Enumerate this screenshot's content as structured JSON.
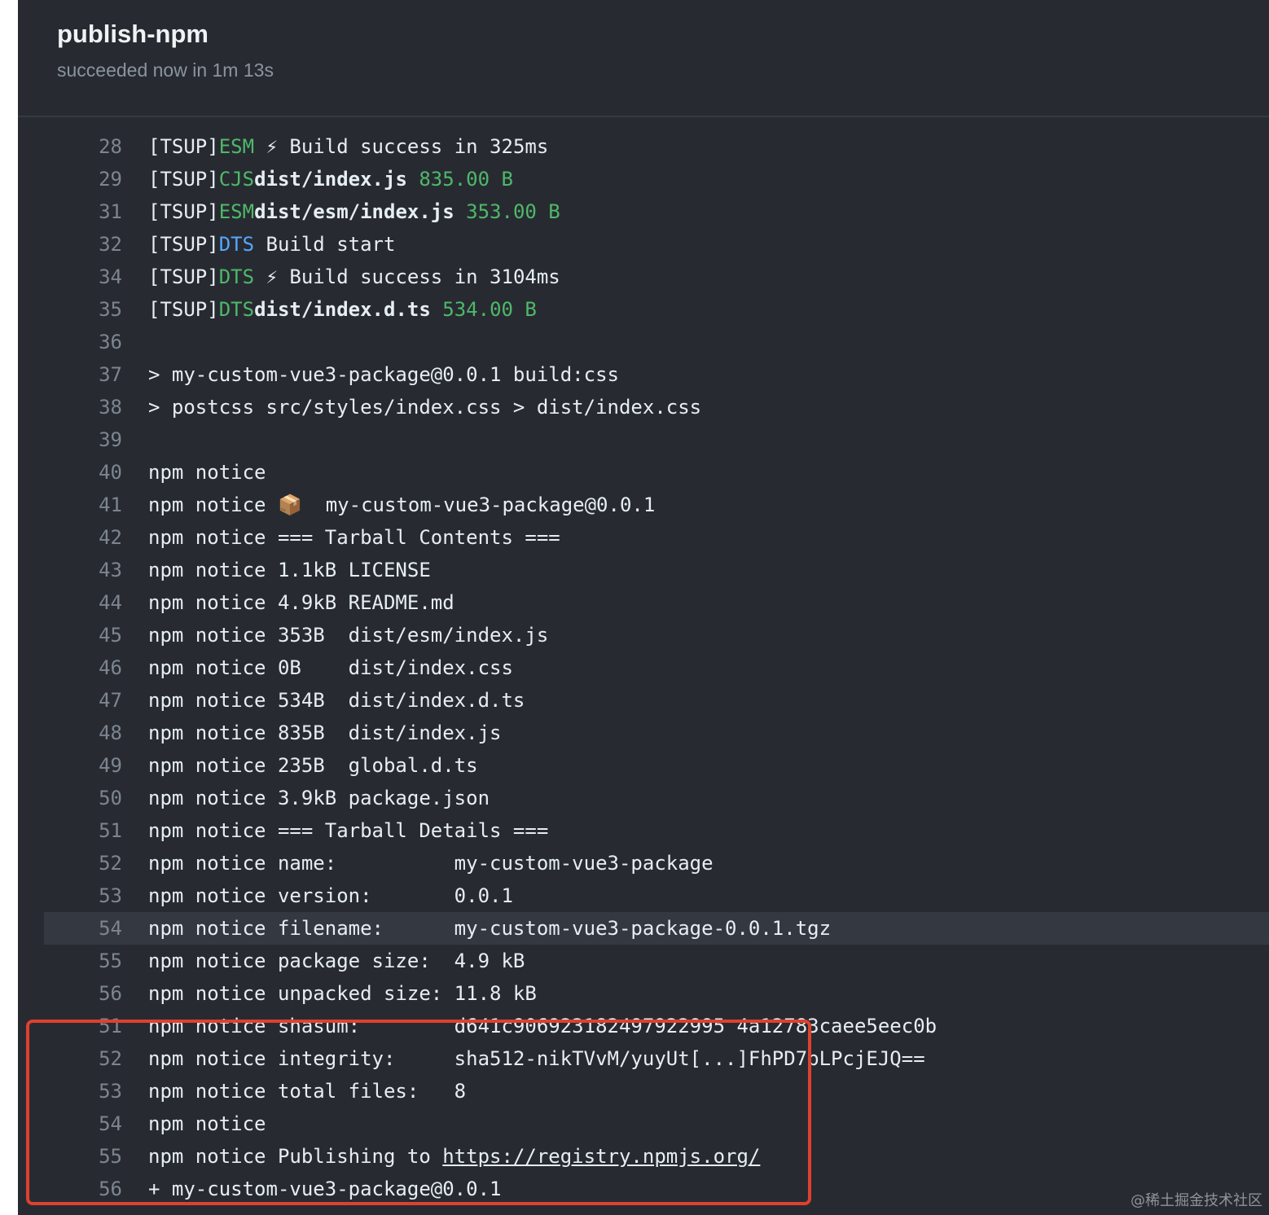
{
  "job": {
    "title": "publish-npm",
    "status": "succeeded now in 1m 13s"
  },
  "log_lines": [
    {
      "num": "28",
      "segments": [
        {
          "t": "[TSUP]"
        },
        {
          "t": "ESM",
          "c": "green"
        },
        {
          "t": " ⚡ Build success in 325ms"
        }
      ]
    },
    {
      "num": "29",
      "segments": [
        {
          "t": "[TSUP]"
        },
        {
          "t": "CJS",
          "c": "green"
        },
        {
          "t": "dist/index.js",
          "c": "bold"
        },
        {
          "t": " "
        },
        {
          "t": "835.00 B",
          "c": "green"
        }
      ]
    },
    {
      "num": "31",
      "segments": [
        {
          "t": "[TSUP]"
        },
        {
          "t": "ESM",
          "c": "green"
        },
        {
          "t": "dist/esm/index.js",
          "c": "bold"
        },
        {
          "t": " "
        },
        {
          "t": "353.00 B",
          "c": "green"
        }
      ]
    },
    {
      "num": "32",
      "segments": [
        {
          "t": "[TSUP]"
        },
        {
          "t": "DTS",
          "c": "blue"
        },
        {
          "t": " Build start"
        }
      ]
    },
    {
      "num": "34",
      "segments": [
        {
          "t": "[TSUP]"
        },
        {
          "t": "DTS",
          "c": "green"
        },
        {
          "t": " ⚡ Build success in 3104ms"
        }
      ]
    },
    {
      "num": "35",
      "segments": [
        {
          "t": "[TSUP]"
        },
        {
          "t": "DTS",
          "c": "green"
        },
        {
          "t": "dist/index.d.ts",
          "c": "bold"
        },
        {
          "t": " "
        },
        {
          "t": "534.00 B",
          "c": "green"
        }
      ]
    },
    {
      "num": "36",
      "segments": []
    },
    {
      "num": "37",
      "segments": [
        {
          "t": "> my-custom-vue3-package@0.0.1 build:css"
        }
      ]
    },
    {
      "num": "38",
      "segments": [
        {
          "t": "> postcss src/styles/index.css > dist/index.css"
        }
      ]
    },
    {
      "num": "39",
      "segments": []
    },
    {
      "num": "40",
      "segments": [
        {
          "t": "npm notice"
        }
      ]
    },
    {
      "num": "41",
      "segments": [
        {
          "t": "npm notice 📦  my-custom-vue3-package@0.0.1"
        }
      ]
    },
    {
      "num": "42",
      "segments": [
        {
          "t": "npm notice === Tarball Contents ==="
        }
      ]
    },
    {
      "num": "43",
      "segments": [
        {
          "t": "npm notice 1.1kB LICENSE"
        }
      ]
    },
    {
      "num": "44",
      "segments": [
        {
          "t": "npm notice 4.9kB README.md"
        }
      ]
    },
    {
      "num": "45",
      "segments": [
        {
          "t": "npm notice 353B  dist/esm/index.js"
        }
      ]
    },
    {
      "num": "46",
      "segments": [
        {
          "t": "npm notice 0B    dist/index.css"
        }
      ]
    },
    {
      "num": "47",
      "segments": [
        {
          "t": "npm notice 534B  dist/index.d.ts"
        }
      ]
    },
    {
      "num": "48",
      "segments": [
        {
          "t": "npm notice 835B  dist/index.js"
        }
      ]
    },
    {
      "num": "49",
      "segments": [
        {
          "t": "npm notice 235B  global.d.ts"
        }
      ]
    },
    {
      "num": "50",
      "segments": [
        {
          "t": "npm notice 3.9kB package.json"
        }
      ]
    },
    {
      "num": "51",
      "segments": [
        {
          "t": "npm notice === Tarball Details ==="
        }
      ]
    },
    {
      "num": "52",
      "segments": [
        {
          "t": "npm notice name:          my-custom-vue3-package"
        }
      ]
    },
    {
      "num": "53",
      "segments": [
        {
          "t": "npm notice version:       0.0.1"
        }
      ]
    },
    {
      "num": "54",
      "highlight": true,
      "segments": [
        {
          "t": "npm notice filename:      my-custom-vue3-package-0.0.1.tgz"
        }
      ]
    },
    {
      "num": "55",
      "segments": [
        {
          "t": "npm notice package size:  4.9 kB"
        }
      ]
    },
    {
      "num": "56",
      "segments": [
        {
          "t": "npm notice unpacked size: 11.8 kB"
        }
      ]
    },
    {
      "num": "51",
      "segments": [
        {
          "t": "npm notice shasum:        d641c906923182497922995 4a12783caee5eec0b"
        }
      ]
    },
    {
      "num": "52",
      "segments": [
        {
          "t": "npm notice integrity:     sha512-nikTVvM/yuyUt[...]FhPD7pLPcjEJQ=="
        }
      ]
    },
    {
      "num": "53",
      "segments": [
        {
          "t": "npm notice total files:   8"
        }
      ]
    },
    {
      "num": "54",
      "segments": [
        {
          "t": "npm notice"
        }
      ]
    },
    {
      "num": "55",
      "segments": [
        {
          "t": "npm notice Publishing to "
        },
        {
          "t": "https://registry.npmjs.org/",
          "c": "link"
        }
      ]
    },
    {
      "num": "56",
      "segments": [
        {
          "t": "+ my-custom-vue3-package@0.0.1"
        }
      ]
    }
  ],
  "watermark": "@稀土掘金技术社区",
  "colors": {
    "annotation": "#e0402e",
    "green": "#4fb86a",
    "blue": "#58a6ff"
  }
}
